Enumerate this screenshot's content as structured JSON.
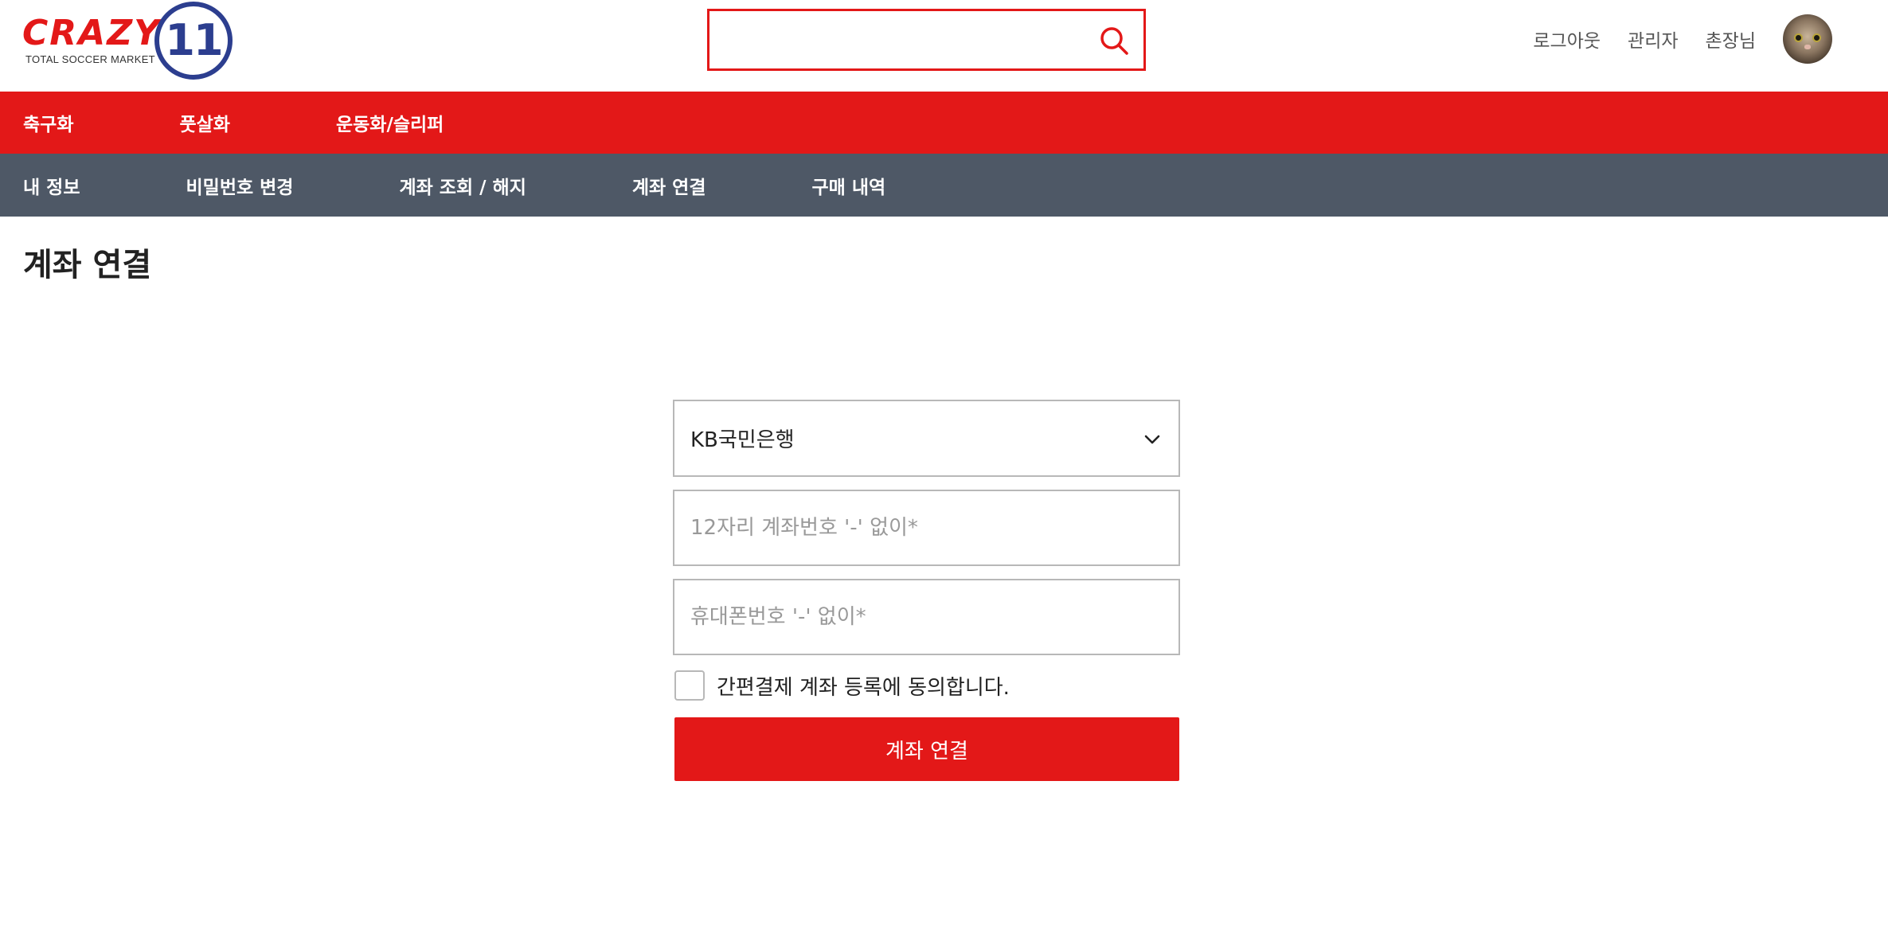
{
  "header": {
    "logo": {
      "word": "CRAZY",
      "number": "11",
      "tagline": "TOTAL SOCCER MARKET"
    },
    "search": {
      "value": "",
      "placeholder": "",
      "icon": "search-icon",
      "accent_color": "#e31818"
    },
    "user_links": [
      "로그아웃",
      "관리자",
      "촌장님"
    ],
    "avatar": "cat-avatar"
  },
  "category_nav": {
    "color": "#e31818",
    "items": [
      "축구화",
      "풋살화",
      "운동화/슬리퍼"
    ]
  },
  "account_nav": {
    "color": "#4e5866",
    "items": [
      "내 정보",
      "비밀번호 변경",
      "계좌 조회 / 해지",
      "계좌 연결",
      "구매 내역"
    ]
  },
  "page": {
    "title": "계좌 연결"
  },
  "form": {
    "bank_select": {
      "value": "KB국민은행",
      "icon": "chevron-down-icon"
    },
    "account_number": {
      "value": "",
      "placeholder": "12자리 계좌번호 '-' 없이*"
    },
    "phone_number": {
      "value": "",
      "placeholder": "휴대폰번호 '-' 없이*"
    },
    "agree": {
      "checked": false,
      "label": "간편결제 계좌 등록에 동의합니다."
    },
    "submit_label": "계좌 연결"
  }
}
